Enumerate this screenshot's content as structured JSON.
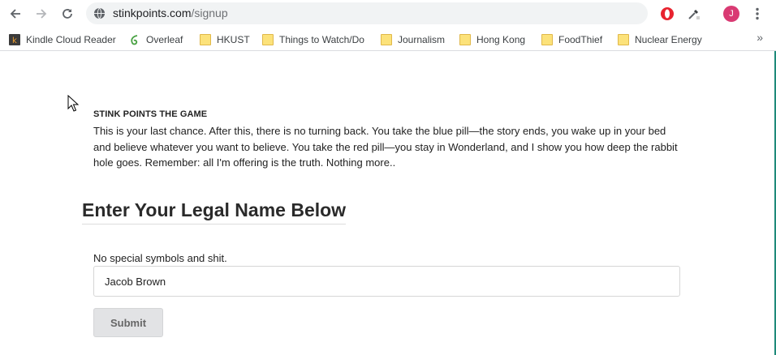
{
  "browser": {
    "url_host": "stinkpoints.com",
    "url_path": "/signup",
    "profile_initial": "J",
    "more_bookmarks": "»",
    "bookmarks": [
      {
        "label": "Kindle Cloud Reader",
        "icon": "kindle-icon"
      },
      {
        "label": "Overleaf",
        "icon": "overleaf-icon"
      },
      {
        "label": "HKUST",
        "icon": "folder-icon"
      },
      {
        "label": "Things to Watch/Do",
        "icon": "folder-icon"
      },
      {
        "label": "Journalism",
        "icon": "folder-icon"
      },
      {
        "label": "Hong Kong",
        "icon": "folder-icon"
      },
      {
        "label": "FoodThief",
        "icon": "folder-icon"
      },
      {
        "label": "Nuclear Energy",
        "icon": "folder-icon"
      }
    ]
  },
  "page": {
    "game_title": "STINK POINTS THE GAME",
    "intro": "This is your last chance. After this, there is no turning back. You take the blue pill—the story ends, you wake up in your bed and believe whatever you want to believe. You take the red pill—you stay in Wonderland, and I show you how deep the rabbit hole goes. Remember: all I'm offering is the truth. Nothing more..",
    "heading": "Enter Your Legal Name Below",
    "field_label": "No special symbols and shit.",
    "name_value": "Jacob Brown",
    "submit_label": "Submit"
  },
  "colors": {
    "avatar": "#d93a73",
    "folder": "#fce27a",
    "submit_bg": "#e2e3e5"
  }
}
